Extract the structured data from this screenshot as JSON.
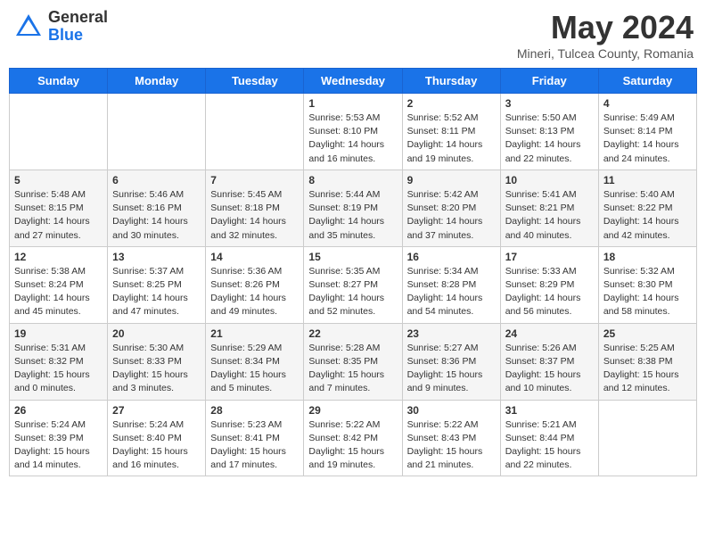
{
  "header": {
    "logo_general": "General",
    "logo_blue": "Blue",
    "main_title": "May 2024",
    "subtitle": "Mineri, Tulcea County, Romania"
  },
  "days_of_week": [
    "Sunday",
    "Monday",
    "Tuesday",
    "Wednesday",
    "Thursday",
    "Friday",
    "Saturday"
  ],
  "weeks": [
    [
      {
        "day": "",
        "sunrise": "",
        "sunset": "",
        "daylight": ""
      },
      {
        "day": "",
        "sunrise": "",
        "sunset": "",
        "daylight": ""
      },
      {
        "day": "",
        "sunrise": "",
        "sunset": "",
        "daylight": ""
      },
      {
        "day": "1",
        "sunrise": "5:53 AM",
        "sunset": "8:10 PM",
        "daylight": "14 hours and 16 minutes."
      },
      {
        "day": "2",
        "sunrise": "5:52 AM",
        "sunset": "8:11 PM",
        "daylight": "14 hours and 19 minutes."
      },
      {
        "day": "3",
        "sunrise": "5:50 AM",
        "sunset": "8:13 PM",
        "daylight": "14 hours and 22 minutes."
      },
      {
        "day": "4",
        "sunrise": "5:49 AM",
        "sunset": "8:14 PM",
        "daylight": "14 hours and 24 minutes."
      }
    ],
    [
      {
        "day": "5",
        "sunrise": "5:48 AM",
        "sunset": "8:15 PM",
        "daylight": "14 hours and 27 minutes."
      },
      {
        "day": "6",
        "sunrise": "5:46 AM",
        "sunset": "8:16 PM",
        "daylight": "14 hours and 30 minutes."
      },
      {
        "day": "7",
        "sunrise": "5:45 AM",
        "sunset": "8:18 PM",
        "daylight": "14 hours and 32 minutes."
      },
      {
        "day": "8",
        "sunrise": "5:44 AM",
        "sunset": "8:19 PM",
        "daylight": "14 hours and 35 minutes."
      },
      {
        "day": "9",
        "sunrise": "5:42 AM",
        "sunset": "8:20 PM",
        "daylight": "14 hours and 37 minutes."
      },
      {
        "day": "10",
        "sunrise": "5:41 AM",
        "sunset": "8:21 PM",
        "daylight": "14 hours and 40 minutes."
      },
      {
        "day": "11",
        "sunrise": "5:40 AM",
        "sunset": "8:22 PM",
        "daylight": "14 hours and 42 minutes."
      }
    ],
    [
      {
        "day": "12",
        "sunrise": "5:38 AM",
        "sunset": "8:24 PM",
        "daylight": "14 hours and 45 minutes."
      },
      {
        "day": "13",
        "sunrise": "5:37 AM",
        "sunset": "8:25 PM",
        "daylight": "14 hours and 47 minutes."
      },
      {
        "day": "14",
        "sunrise": "5:36 AM",
        "sunset": "8:26 PM",
        "daylight": "14 hours and 49 minutes."
      },
      {
        "day": "15",
        "sunrise": "5:35 AM",
        "sunset": "8:27 PM",
        "daylight": "14 hours and 52 minutes."
      },
      {
        "day": "16",
        "sunrise": "5:34 AM",
        "sunset": "8:28 PM",
        "daylight": "14 hours and 54 minutes."
      },
      {
        "day": "17",
        "sunrise": "5:33 AM",
        "sunset": "8:29 PM",
        "daylight": "14 hours and 56 minutes."
      },
      {
        "day": "18",
        "sunrise": "5:32 AM",
        "sunset": "8:30 PM",
        "daylight": "14 hours and 58 minutes."
      }
    ],
    [
      {
        "day": "19",
        "sunrise": "5:31 AM",
        "sunset": "8:32 PM",
        "daylight": "15 hours and 0 minutes."
      },
      {
        "day": "20",
        "sunrise": "5:30 AM",
        "sunset": "8:33 PM",
        "daylight": "15 hours and 3 minutes."
      },
      {
        "day": "21",
        "sunrise": "5:29 AM",
        "sunset": "8:34 PM",
        "daylight": "15 hours and 5 minutes."
      },
      {
        "day": "22",
        "sunrise": "5:28 AM",
        "sunset": "8:35 PM",
        "daylight": "15 hours and 7 minutes."
      },
      {
        "day": "23",
        "sunrise": "5:27 AM",
        "sunset": "8:36 PM",
        "daylight": "15 hours and 9 minutes."
      },
      {
        "day": "24",
        "sunrise": "5:26 AM",
        "sunset": "8:37 PM",
        "daylight": "15 hours and 10 minutes."
      },
      {
        "day": "25",
        "sunrise": "5:25 AM",
        "sunset": "8:38 PM",
        "daylight": "15 hours and 12 minutes."
      }
    ],
    [
      {
        "day": "26",
        "sunrise": "5:24 AM",
        "sunset": "8:39 PM",
        "daylight": "15 hours and 14 minutes."
      },
      {
        "day": "27",
        "sunrise": "5:24 AM",
        "sunset": "8:40 PM",
        "daylight": "15 hours and 16 minutes."
      },
      {
        "day": "28",
        "sunrise": "5:23 AM",
        "sunset": "8:41 PM",
        "daylight": "15 hours and 17 minutes."
      },
      {
        "day": "29",
        "sunrise": "5:22 AM",
        "sunset": "8:42 PM",
        "daylight": "15 hours and 19 minutes."
      },
      {
        "day": "30",
        "sunrise": "5:22 AM",
        "sunset": "8:43 PM",
        "daylight": "15 hours and 21 minutes."
      },
      {
        "day": "31",
        "sunrise": "5:21 AM",
        "sunset": "8:44 PM",
        "daylight": "15 hours and 22 minutes."
      },
      {
        "day": "",
        "sunrise": "",
        "sunset": "",
        "daylight": ""
      }
    ]
  ]
}
